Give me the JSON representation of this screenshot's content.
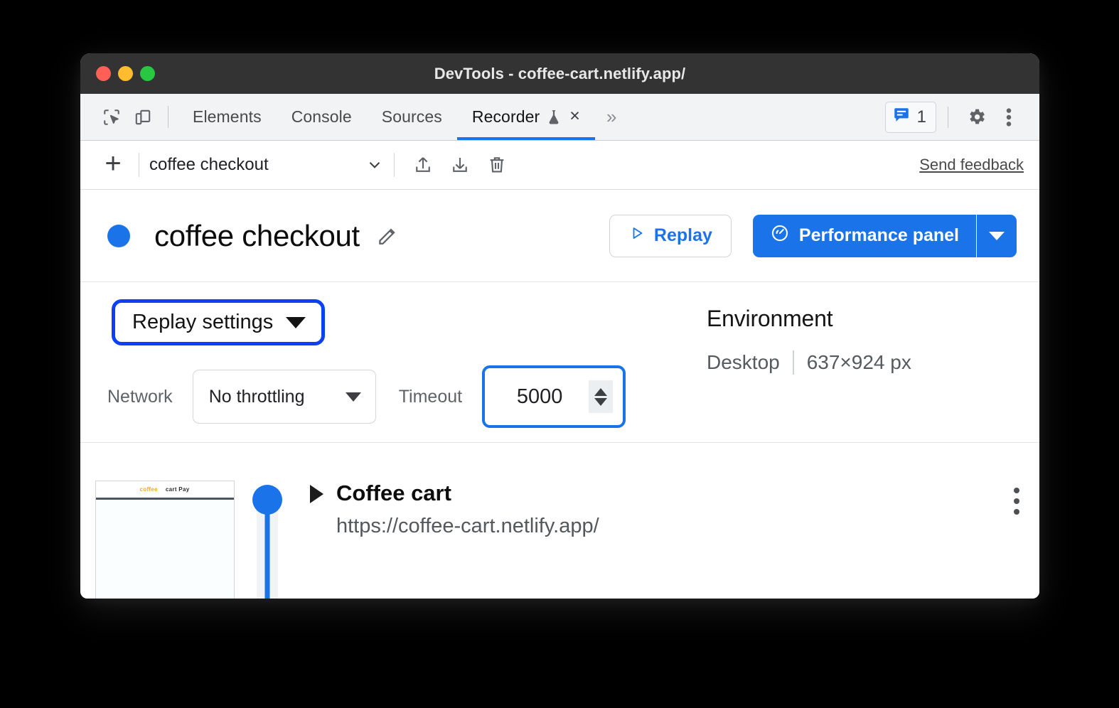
{
  "window": {
    "title": "DevTools - coffee-cart.netlify.app/",
    "traffic_lights": [
      "close",
      "minimize",
      "maximize"
    ]
  },
  "tabbar": {
    "inspect_icon": "inspect-element-icon",
    "device_icon": "device-toolbar-icon",
    "tabs": [
      {
        "label": "Elements",
        "active": false
      },
      {
        "label": "Console",
        "active": false
      },
      {
        "label": "Sources",
        "active": false
      },
      {
        "label": "Recorder",
        "active": true,
        "experimental_icon": "flask-icon",
        "close_label": "×"
      }
    ],
    "more_tabs_label": "»",
    "issues": {
      "icon": "issues-message-icon",
      "count": "1",
      "color": "#1a73e8"
    },
    "settings_icon": "gear-icon",
    "menu_icon": "kebab-menu-icon"
  },
  "recorder_toolbar": {
    "add_label": "+",
    "recording_name": "coffee checkout",
    "dropdown_icon": "chevron-down-icon",
    "export_icon": "export-upload-icon",
    "import_icon": "import-download-icon",
    "delete_icon": "trash-icon",
    "feedback_label": "Send feedback"
  },
  "recording_header": {
    "status_dot_color": "#1a73e8",
    "title": "coffee checkout",
    "edit_icon": "pencil-edit-icon",
    "replay_label": "Replay",
    "replay_icon": "play-triangle-icon",
    "performance_label": "Performance panel",
    "performance_icon": "speedometer-icon",
    "performance_caret_icon": "caret-down-icon",
    "accent_color": "#1a73e8"
  },
  "replay_settings": {
    "toggle_label": "Replay settings",
    "toggle_caret_icon": "caret-down-icon",
    "highlight_color": "#0b41f5",
    "network_label": "Network",
    "network_value": "No throttling",
    "network_caret_icon": "caret-down-icon",
    "timeout_label": "Timeout",
    "timeout_value": "5000",
    "timeout_spinner_icon": "stepper-arrows-icon",
    "timeout_highlight_color": "#1a73e8"
  },
  "environment": {
    "title": "Environment",
    "device": "Desktop",
    "viewport": "637×924 px"
  },
  "steps": {
    "thumbnail": {
      "name": "step-screenshot-thumbnail",
      "logo_text": "coffee",
      "nav_text": "cart Pay"
    },
    "timeline_color": "#1a73e8",
    "items": [
      {
        "expander_icon": "triangle-right-icon",
        "title": "Coffee cart",
        "url": "https://coffee-cart.netlify.app/",
        "menu_icon": "kebab-menu-icon"
      }
    ]
  }
}
